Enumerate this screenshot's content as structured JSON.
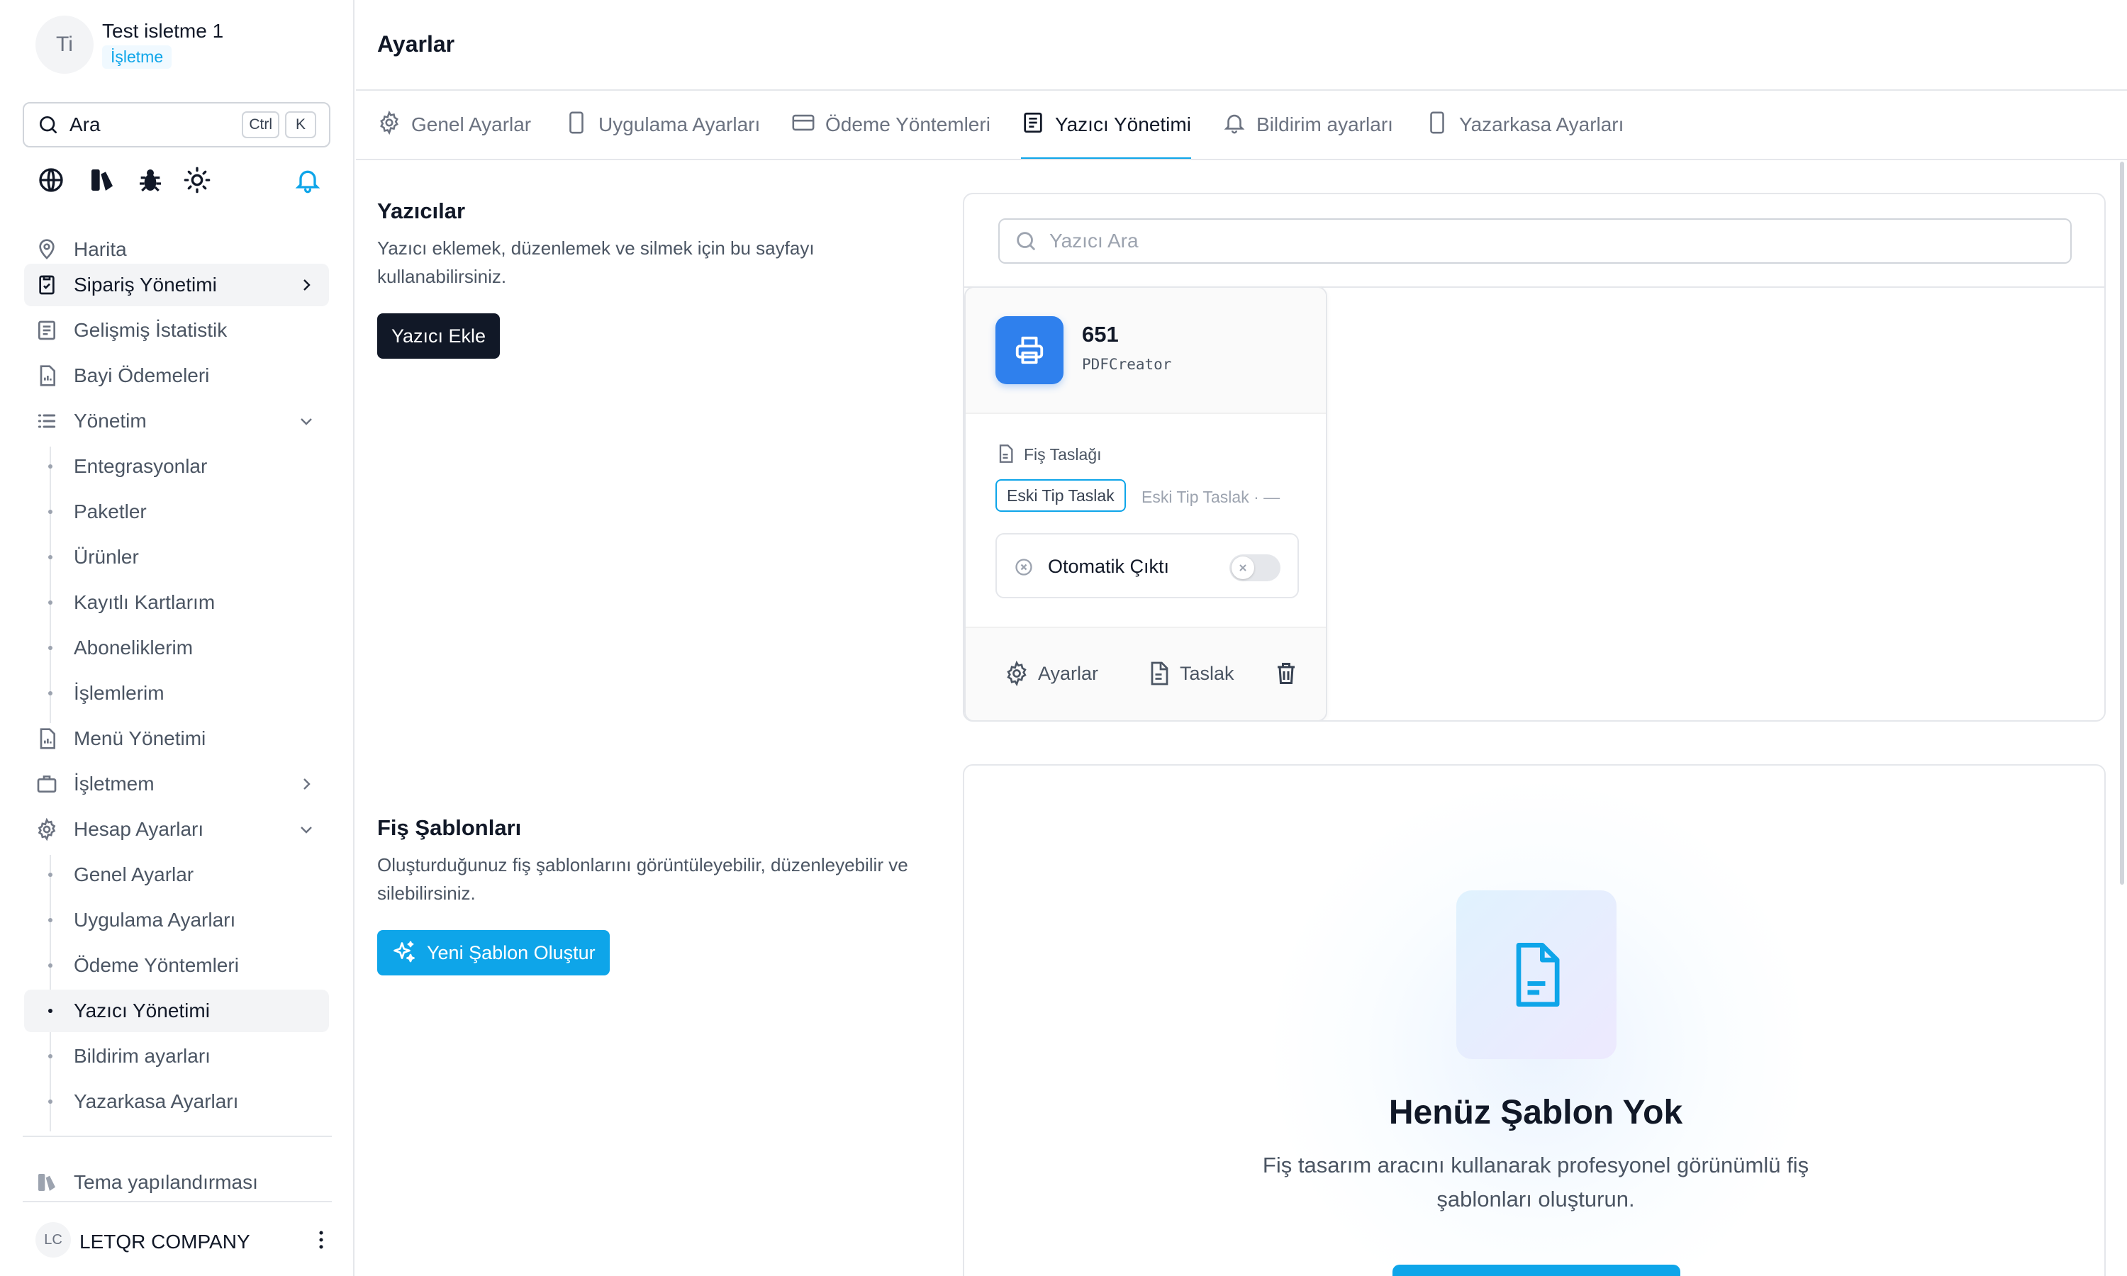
{
  "sidebar": {
    "account": {
      "initials": "Ti",
      "name": "Test isletme 1",
      "type": "İşletme"
    },
    "search": {
      "label": "Ara",
      "kbd1": "Ctrl",
      "kbd2": "K"
    },
    "quick_icons": [
      "globe-icon",
      "theme-icon",
      "bug-icon",
      "sun-icon",
      "bell-icon"
    ],
    "items": [
      {
        "label": "Harita",
        "icon": "map-pin-icon"
      },
      {
        "label": "Sipariş Yönetimi",
        "icon": "clipboard-check-icon"
      },
      {
        "label": "Gelişmiş İstatistik",
        "icon": "stats-icon"
      },
      {
        "label": "Bayi Ödemeleri",
        "icon": "file-chart-icon"
      },
      {
        "label": "Yönetim",
        "icon": "list-icon"
      },
      {
        "label": "Menü Yönetimi",
        "icon": "file-chart-icon"
      },
      {
        "label": "İşletmem",
        "icon": "briefcase-icon"
      },
      {
        "label": "Hesap Ayarları",
        "icon": "gear-icon"
      }
    ],
    "yonetim_sub": [
      "Entegrasyonlar",
      "Paketler",
      "Ürünler",
      "Kayıtlı Kartlarım",
      "Aboneliklerim",
      "İşlemlerim"
    ],
    "hesap_sub": [
      "Genel Ayarlar",
      "Uygulama Ayarları",
      "Ödeme Yöntemleri",
      "Yazıcı Yönetimi",
      "Bildirim ayarları",
      "Yazarkasa Ayarları"
    ],
    "theme": "Tema yapılandırması",
    "company": {
      "initials": "LC",
      "name": "LETQR COMPANY"
    }
  },
  "header": {
    "title": "Ayarlar"
  },
  "tabs": [
    {
      "label": "Genel Ayarlar",
      "icon": "gear-icon"
    },
    {
      "label": "Uygulama Ayarları",
      "icon": "phone-icon"
    },
    {
      "label": "Ödeme Yöntemleri",
      "icon": "credit-card-icon"
    },
    {
      "label": "Yazıcı Yönetimi",
      "icon": "document-icon"
    },
    {
      "label": "Bildirim ayarları",
      "icon": "bell-icon"
    },
    {
      "label": "Yazarkasa Ayarları",
      "icon": "phone-icon"
    }
  ],
  "printers": {
    "title": "Yazıcılar",
    "desc": "Yazıcı eklemek, düzenlemek ve silmek için bu sayfayı kullanabilirsiniz.",
    "add_button": "Yazıcı Ekle",
    "search_placeholder": "Yazıcı Ara",
    "card": {
      "name": "651",
      "driver": "PDFCreator",
      "template_label": "Fiş Taslağı",
      "template_chip": "Eski Tip Taslak",
      "template_secondary": "Eski Tip Taslak · —",
      "auto_print": "Otomatik Çıktı",
      "auto_print_on": false,
      "settings": "Ayarlar",
      "template": "Taslak"
    }
  },
  "templates": {
    "title": "Fiş Şablonları",
    "desc": "Oluşturduğunuz fiş şablonlarını görüntüleyebilir, düzenleyebilir ve silebilirsiniz.",
    "new_button": "Yeni Şablon Oluştur",
    "empty_title": "Henüz Şablon Yok",
    "empty_desc": "Fiş tasarım aracını kullanarak profesyonel görünümlü fiş şablonları oluşturun."
  },
  "colors": {
    "accent": "#0ea5e9",
    "dark": "#111827",
    "printer_badge": "#2f80ed"
  }
}
